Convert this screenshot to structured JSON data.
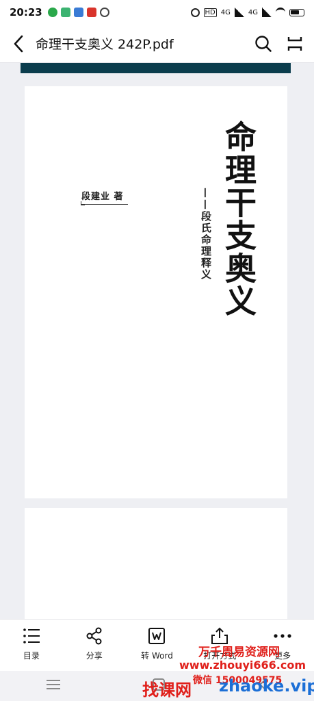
{
  "status_bar": {
    "time": "20:23",
    "signal_labels": [
      "HD",
      "4G",
      "4G"
    ]
  },
  "header": {
    "title": "命理干支奥义  242P.pdf",
    "icons": [
      "back-arrow-icon",
      "search-icon",
      "more-options-icon"
    ]
  },
  "document": {
    "author": "段建业  著",
    "book_title": "命理干支奥义",
    "subtitle": "——段氏命理释义"
  },
  "toolbar": {
    "items": [
      {
        "label": "目录",
        "icon": "contents-icon"
      },
      {
        "label": "分享",
        "icon": "share-icon"
      },
      {
        "label": "转 Word",
        "icon": "convert-word-icon"
      },
      {
        "label": "打开方式",
        "icon": "open-with-icon"
      },
      {
        "label": "更多",
        "icon": "more-dots-icon"
      }
    ]
  },
  "watermark": {
    "line1": "万千周易资源网",
    "line2": "www.zhouyi666.com",
    "line3": "微信 1500049575",
    "brand_left": "找课网",
    "brand_right": "zhaoke.vip"
  },
  "colors": {
    "accent_strip": "#0b3d4d",
    "watermark_red": "#e0201b",
    "watermark_blue": "#1c6fd6"
  }
}
